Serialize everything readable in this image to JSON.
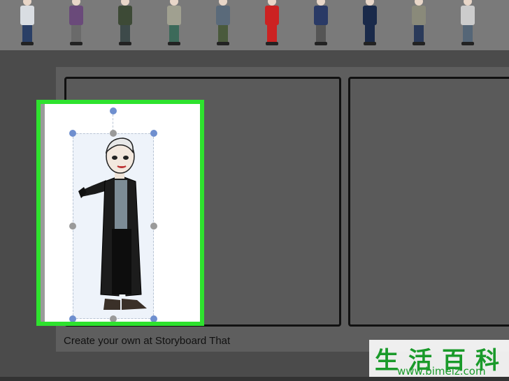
{
  "character_strip": {
    "characters": [
      {
        "name": "character-1",
        "shirt": "#d9dde2",
        "pants": "#2a3f66"
      },
      {
        "name": "character-2",
        "shirt": "#6a4a7a",
        "pants": "#6a6a6a"
      },
      {
        "name": "character-3",
        "shirt": "#3d4a36",
        "pants": "#3d4a4a"
      },
      {
        "name": "character-4",
        "shirt": "#a0a090",
        "pants": "#3c6a5a"
      },
      {
        "name": "character-5",
        "shirt": "#5a6a7a",
        "pants": "#4a5a3c"
      },
      {
        "name": "character-6",
        "shirt": "#cc2222",
        "pants": "#cc2222"
      },
      {
        "name": "character-7",
        "shirt": "#2a3a66",
        "pants": "#555555"
      },
      {
        "name": "character-8",
        "shirt": "#1a2a4a",
        "pants": "#1a2a4a"
      },
      {
        "name": "character-9",
        "shirt": "#8a8a7a",
        "pants": "#2a3a5a"
      },
      {
        "name": "character-10",
        "shirt": "#cccccc",
        "pants": "#556677"
      }
    ]
  },
  "storyboard": {
    "caption": "Create your own at Storyboard That"
  },
  "selection": {
    "highlight_color": "#2ee22e",
    "handle_color": "#6f8fcf"
  },
  "watermark": {
    "chinese_text": "生活百科",
    "url_text": "www.bimeiz.com"
  }
}
